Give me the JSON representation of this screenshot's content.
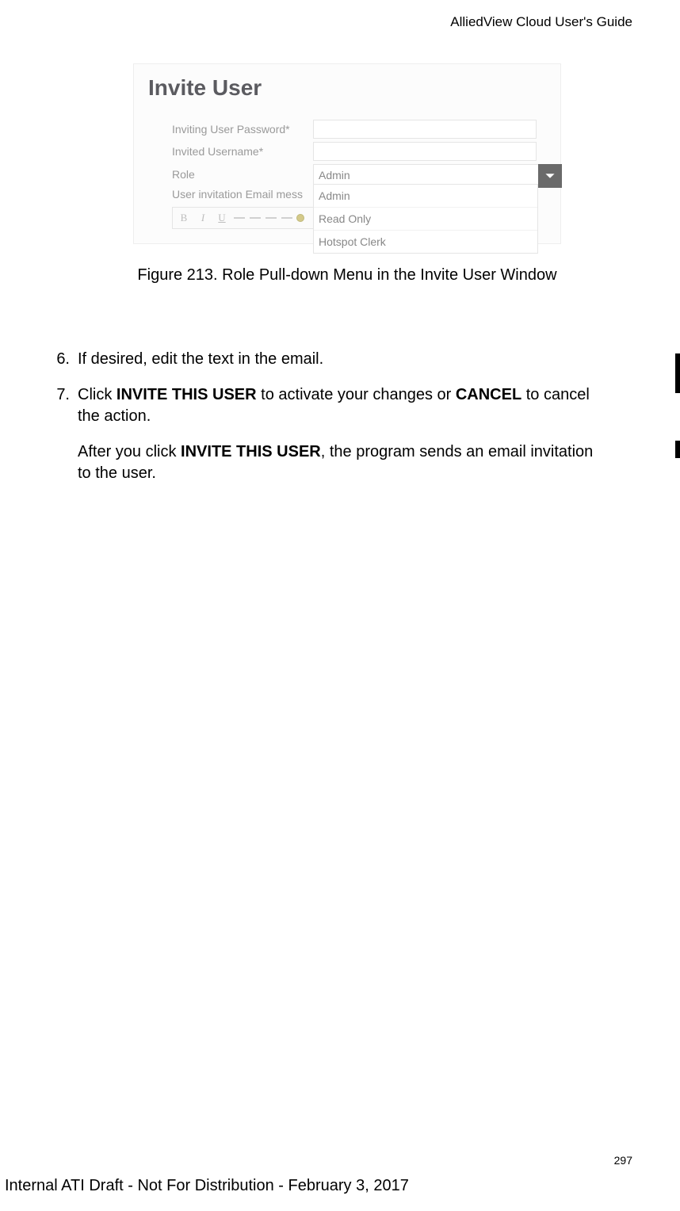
{
  "header": {
    "doc_title": "AlliedView Cloud User's Guide"
  },
  "figure": {
    "panel_title": "Invite User",
    "fields": {
      "password_label": "Inviting User Password*",
      "username_label": "Invited Username*",
      "role_label": "Role",
      "email_msg_label": "User invitation Email mess"
    },
    "role_selected": "Admin",
    "role_options": [
      "Admin",
      "Read Only",
      "Hotspot Clerk"
    ],
    "toolbar": {
      "bold": "B",
      "italic": "I",
      "underline": "U"
    },
    "caption": "Figure 213. Role Pull-down Menu in the Invite User Window"
  },
  "steps": {
    "s6_num": "6.",
    "s6_text": "If desired, edit the text in the email.",
    "s7_num": "7.",
    "s7_pre": "Click ",
    "s7_b1": "INVITE THIS USER",
    "s7_mid": " to activate your changes or ",
    "s7_b2": "CANCEL",
    "s7_post": " to cancel the action.",
    "after_pre": "After you click ",
    "after_b": "INVITE THIS USER",
    "after_post": ", the program sends an email invitation to the user."
  },
  "footer": {
    "page_number": "297",
    "draft_note": "Internal ATI Draft - Not For Distribution - February 3, 2017"
  }
}
